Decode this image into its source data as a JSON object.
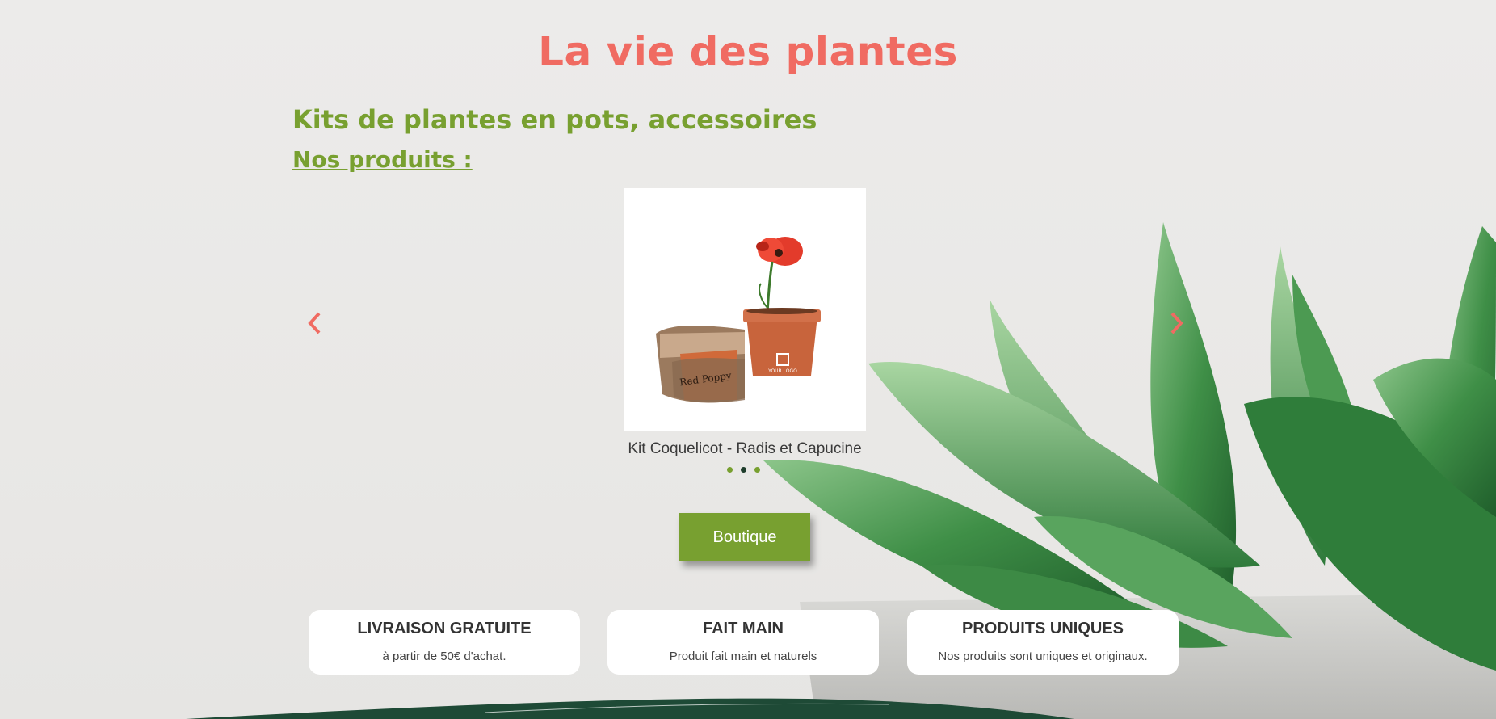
{
  "header": {
    "site_title": "La vie des plantes"
  },
  "section": {
    "subtitle": "Kits de plantes en pots, accessoires",
    "products_heading": "Nos produits :"
  },
  "carousel": {
    "prev_icon": "chevron-left-icon",
    "next_icon": "chevron-right-icon",
    "arrow_color": "#f06b62",
    "current_product": {
      "name": "Kit Coquelicot - Radis et Capucine",
      "pot_label": "Red Poppy",
      "logo_text": "YOUR LOGO"
    },
    "dots_count": 3,
    "active_dot": 2
  },
  "cta": {
    "shop_label": "Boutique"
  },
  "features": [
    {
      "title": "LIVRAISON GRATUITE",
      "description": "à partir de 50€ d'achat."
    },
    {
      "title": "FAIT MAIN",
      "description": "Produit fait main et naturels"
    },
    {
      "title": "PRODUITS UNIQUES",
      "description": "Nos produits sont uniques et originaux."
    }
  ],
  "colors": {
    "title": "#f06b62",
    "accent_green": "#78a030",
    "dark_green": "#1e3d2b",
    "background": "#ebeae8"
  }
}
